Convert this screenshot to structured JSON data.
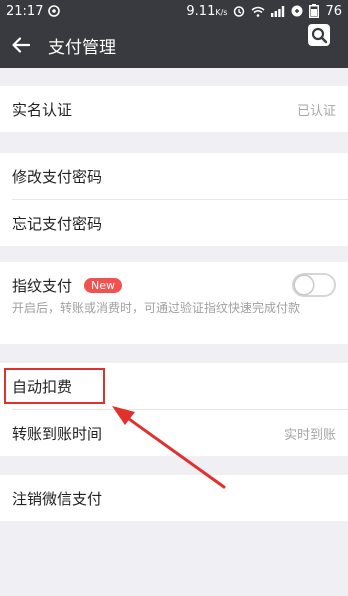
{
  "status_bar": {
    "time": "21:17",
    "speed": "9.11",
    "speed_unit": "K/s",
    "battery": "76"
  },
  "header": {
    "title": "支付管理"
  },
  "groups": {
    "verify": {
      "label": "实名认证",
      "value": "已认证"
    },
    "password": {
      "change_label": "修改支付密码",
      "forget_label": "忘记支付密码"
    },
    "fingerprint": {
      "label": "指纹支付",
      "badge": "New",
      "description": "开启后，转账或消费时，可通过验证指纹快速完成付款",
      "enabled": false
    },
    "auto": {
      "auto_deduct_label": "自动扣费",
      "transfer_time_label": "转账到账时间",
      "transfer_time_value": "实时到账"
    },
    "cancel": {
      "label": "注销微信支付"
    }
  },
  "colors": {
    "header_bg": "#393a3f",
    "page_bg": "#efeff4",
    "badge": "#f2524f",
    "annotation": "#e0312c"
  }
}
